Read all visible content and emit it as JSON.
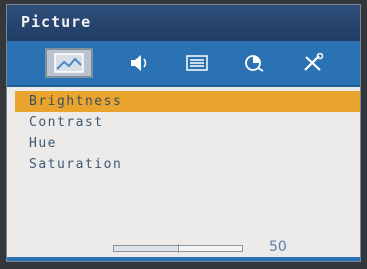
{
  "header": {
    "title": "Picture"
  },
  "tabs": [
    {
      "icon": "picture-icon",
      "selected": true
    },
    {
      "icon": "speaker-icon",
      "selected": false
    },
    {
      "icon": "list-icon",
      "selected": false
    },
    {
      "icon": "color-icon",
      "selected": false
    },
    {
      "icon": "tools-icon",
      "selected": false
    }
  ],
  "menu": {
    "items": [
      {
        "label": "Brightness",
        "selected": true
      },
      {
        "label": "Contrast",
        "selected": false
      },
      {
        "label": "Hue",
        "selected": false
      },
      {
        "label": "Saturation",
        "selected": false
      }
    ]
  },
  "slider": {
    "value": "50",
    "level_percent": 50
  },
  "colors": {
    "title_bar": "#1f3c64",
    "icon_bar": "#2a72b3",
    "highlight": "#e9a42e",
    "text": "#3e5a74",
    "value_text": "#5a7fa8"
  }
}
